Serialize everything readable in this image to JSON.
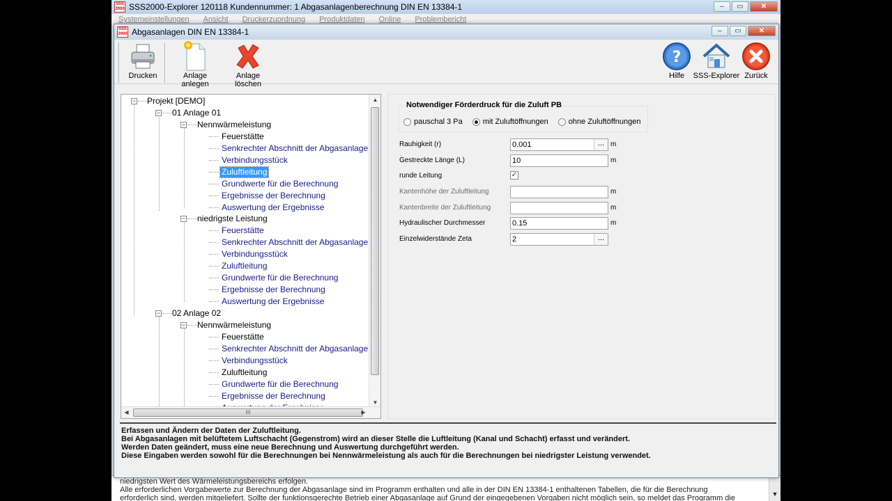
{
  "outer": {
    "title": "SSS2000-Explorer 120118 Kundennummer: 1   Abgasanlagenberechnung DIN EN 13384-1",
    "menu": [
      "Systemeinstellungen",
      "Ansicht",
      "Druckerzuordnung",
      "Produktdaten",
      "Online",
      "Problembericht"
    ],
    "bottom_lines": [
      "niedrigsten Wert des Wärmeleistungsbereichs erfolgen.",
      "Alle erforderlichen Vorgabewerte zur Berechnung der Abgasanlage sind im Programm enthalten und alle in der DIN EN 13384-1 enthaltenen Tabellen, die für die Berechnung",
      "erforderlich sind, werden mitgeliefert. Sollte der funktionsgerechte Betrieb einer Abgasanlage auf Grund der eingegebenen Vorgaben nicht möglich sein, so meldet das Programm die"
    ]
  },
  "dialog": {
    "title": "Abgasanlagen DIN EN 13384-1",
    "toolbar": {
      "print": "Drucken",
      "new": "Anlage anlegen",
      "delete": "Anlage löschen",
      "help": "Hilfe",
      "explorer": "SSS-Explorer",
      "back": "Zurück"
    }
  },
  "tree": {
    "root": "Projekt [DEMO]",
    "a1": "01 Anlage 01",
    "a1_nenn": "Nennwärmeleistung",
    "a1_niedr": "niedrigste Leistung",
    "a2": "02 Anlage 02",
    "a2_nenn": "Nennwärmeleistung",
    "leaves": [
      "Feuerstätte",
      "Senkrechter Abschnitt der Abgasanlage",
      "Verbindungsstück",
      "Zuluftleitung",
      "Grundwerte für die Berechnung",
      "Ergebnisse der Berechnung",
      "Auswertung der Ergebnisse"
    ],
    "hscroll_grip": "III"
  },
  "panel": {
    "group_title": "Notwendiger Förderdruck für die Zuluft PB",
    "radios": [
      "pauschal 3 Pa",
      "mit Zuluftöffnungen",
      "ohne Zuluftöffnungen"
    ],
    "rows": {
      "rauhigkeit": {
        "label": "Rauhigkeit (r)",
        "value": "0.001",
        "unit": "m"
      },
      "laenge": {
        "label": "Gestreckte Länge (L)",
        "value": "10",
        "unit": "m"
      },
      "rund": {
        "label": "runde Leitung",
        "checked": "✓"
      },
      "kantenhoehe": {
        "label": "Kantenhöhe der Zuluftleitung",
        "value": "",
        "unit": "m"
      },
      "kantenbreite": {
        "label": "Kantenbreite der Zuluftleitung",
        "value": "",
        "unit": "m"
      },
      "hydraulisch": {
        "label": "Hydraulischer Durchmesser",
        "value": "0.15",
        "unit": "m"
      },
      "zeta": {
        "label": "Einzelwiderstände Zeta",
        "value": "2"
      }
    },
    "dots": "..."
  },
  "description": [
    "Erfassen und Ändern der Daten der Zuluftleitung.",
    "Bei Abgasanlagen mit belüftetem Luftschacht (Gegenstrom) wird an dieser Stelle die Luftleitung (Kanal und Schacht) erfasst und verändert.",
    "Werden Daten geändert, muss eine neue Berechnung und Auswertung durchgeführt werden.",
    "Diese Eingaben werden sowohl für die Berechnungen bei Nennwärmeleistung als auch für die Berechnungen bei niedrigster Leistung verwendet."
  ]
}
